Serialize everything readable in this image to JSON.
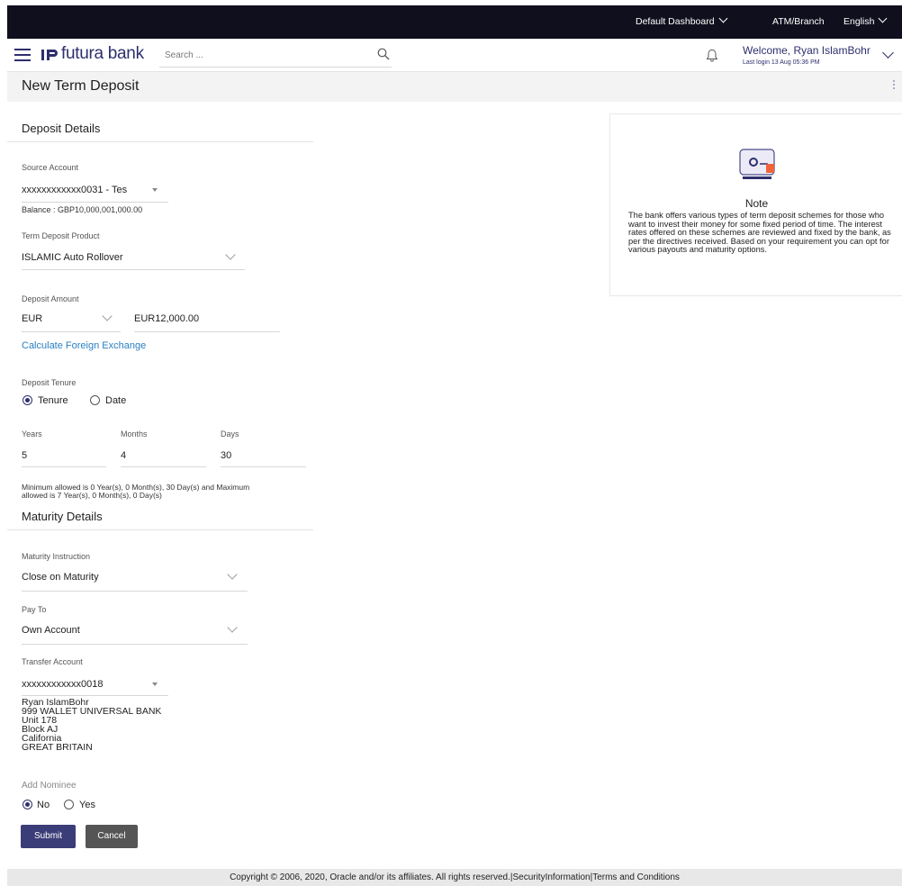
{
  "topbar": {
    "dashboard_label": "Default Dashboard",
    "atm_label": "ATM/Branch",
    "language_label": "English"
  },
  "header": {
    "brand": "futura bank",
    "search_placeholder": "Search ...",
    "welcome": "Welcome, Ryan IslamBohr",
    "last_login": "Last login 13 Aug 05:36 PM"
  },
  "page": {
    "title": "New Term Deposit"
  },
  "deposit_details": {
    "section_title": "Deposit Details",
    "source_account_label": "Source Account",
    "source_account_value": "xxxxxxxxxxxx0031 - Tes",
    "balance": "Balance : GBP10,000,001,000.00",
    "product_label": "Term Deposit Product",
    "product_value": "ISLAMIC Auto Rollover",
    "amount_label": "Deposit Amount",
    "currency_value": "EUR",
    "amount_value": "EUR12,000.00",
    "fx_link": "Calculate Foreign Exchange",
    "tenure_label": "Deposit Tenure",
    "tenure_option": "Tenure",
    "date_option": "Date",
    "tenure_selected": "Tenure",
    "years_label": "Years",
    "months_label": "Months",
    "days_label": "Days",
    "years_value": "5",
    "months_value": "4",
    "days_value": "30",
    "tenure_hint_line1": "Minimum allowed is 0 Year(s), 0 Month(s), 30 Day(s) and Maximum",
    "tenure_hint_line2": "allowed is 7 Year(s), 0 Month(s), 0 Day(s)"
  },
  "maturity_details": {
    "section_title": "Maturity Details",
    "instruction_label": "Maturity Instruction",
    "instruction_value": "Close on Maturity",
    "pay_to_label": "Pay To",
    "pay_to_value": "Own Account",
    "transfer_account_label": "Transfer Account",
    "transfer_account_value": "xxxxxxxxxxxx0018",
    "address": [
      "Ryan IslamBohr",
      "999 WALLET UNIVERSAL BANK",
      "Unit 178",
      "Block AJ",
      "California",
      "GREAT BRITAIN"
    ],
    "nominee_label": "Add Nominee",
    "nominee_no": "No",
    "nominee_yes": "Yes",
    "nominee_selected": "No"
  },
  "actions": {
    "submit_label": "Submit",
    "cancel_label": "Cancel"
  },
  "note": {
    "title": "Note",
    "text": "The bank offers various types of term deposit schemes for those who want to invest their money for some fixed period of time. The interest rates offered on these schemes are reviewed and fixed by the bank, as per the directives received. Based on your requirement you can opt for various payouts and maturity options."
  },
  "footer": {
    "text": "Copyright © 2006, 2020, Oracle and/or its affiliates. All rights reserved.|SecurityInformation|Terms and Conditions"
  },
  "colors": {
    "brand": "#2d2f6e",
    "topbar": "#0f0f1e",
    "link": "#2a7fc1",
    "submit": "#3b3d78",
    "cancel": "#555555",
    "note_icon_accent": "#f0643c"
  }
}
